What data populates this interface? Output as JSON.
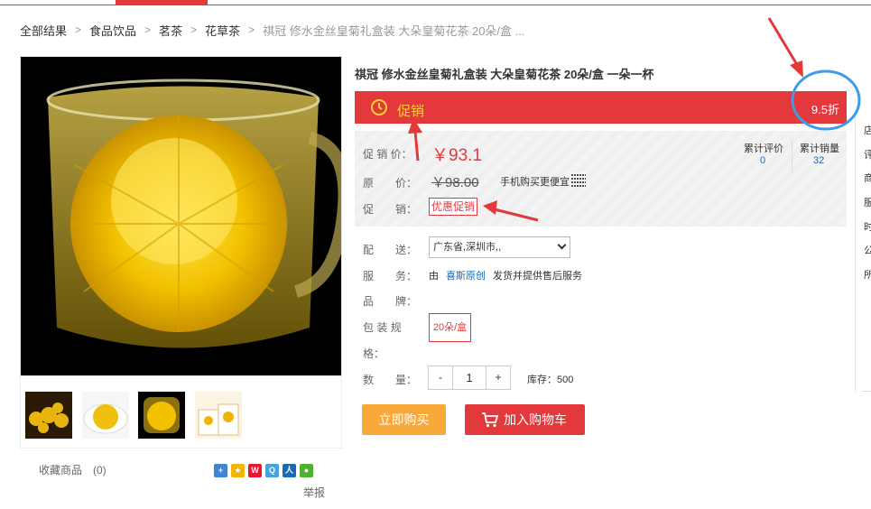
{
  "breadcrumb": {
    "items": [
      "全部结果",
      "食品饮品",
      "茗茶",
      "花草茶"
    ],
    "current": "祺冠 修水金丝皇菊礼盒装 大朵皇菊花茶 20朵/盒 ..."
  },
  "product": {
    "title": "祺冠 修水金丝皇菊礼盒装 大朵皇菊花茶 20朵/盒 一朵一杯",
    "promo_banner_label": "促销",
    "discount": "9.5折",
    "sale_price_label": "促 销 价：",
    "sale_price": "￥93.1",
    "original_price_label": "原　　价：",
    "original_price": "￥98.00",
    "mobile_cheaper": "手机购买更便宜",
    "promotion_label": "促　　销：",
    "promotion_tag": "优惠促销",
    "review_count_label": "累计评价",
    "review_count": "0",
    "sales_count_label": "累计销量",
    "sales_count": "32",
    "delivery_label": "配　　送：",
    "delivery_value": "广东省,深圳市,,",
    "service_label": "服　　务：",
    "service_prefix": "由",
    "seller": "喜斯原创",
    "service_suffix": "发货并提供售后服务",
    "brand_label": "品　　牌：",
    "spec_label_line1": "包 装 规",
    "spec_label_line2": "格：",
    "spec_option": "20朵/盒",
    "quantity_label": "数　　量：",
    "quantity_minus": "-",
    "quantity_value": "1",
    "quantity_plus": "+",
    "stock": "库存：500",
    "buy_now": "立即购买",
    "add_to_cart": "加入购物车"
  },
  "gallery": {
    "favorite": "收藏商品　(0)",
    "report": "举报"
  },
  "side_panel": {
    "chars": [
      "店",
      "评",
      "商",
      "服",
      "时",
      "公",
      "所"
    ]
  },
  "colors": {
    "accent_red": "#e4393c",
    "promo_yellow": "#ffd43b",
    "buy_orange": "#f9a83a",
    "link_blue": "#1a6ab3",
    "annotation_blue": "#3d9be9"
  },
  "icons": {
    "share": [
      "plus-share-icon",
      "qzone-icon",
      "weibo-icon",
      "tencent-weibo-icon",
      "renren-icon",
      "wechat-icon"
    ]
  }
}
